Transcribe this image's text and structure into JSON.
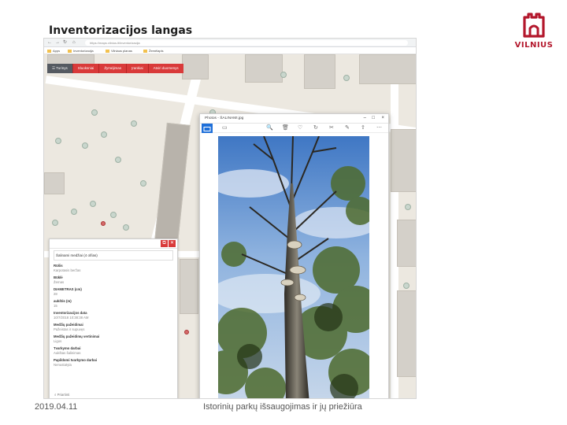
{
  "slide": {
    "title": "Inventorizacijos langas",
    "logo_text": "VILNIUS",
    "footer_date": "2019.04.11",
    "footer_caption": "Istorinių parkų išsaugojimas ir jų priežiūra"
  },
  "colors": {
    "brand_red": "#b3172c",
    "toolbar_red": "#d93a3a",
    "toolbar_dark": "#555a61",
    "viewer_accent": "#1e6fd9"
  },
  "browser": {
    "url": "https://maps.vilnius.lt/inventorizacija",
    "bookmarks": [
      "Apps",
      "Inventorizacija",
      "Vilniaus planas",
      "Žemėlapis"
    ]
  },
  "map_toolbar": {
    "items": [
      {
        "label": "☰ Turinys",
        "style": "dark"
      },
      {
        "label": "Sluoksniai",
        "style": "red"
      },
      {
        "label": "Žymėjimas",
        "style": "red"
      },
      {
        "label": "Įrankiai",
        "style": "red"
      },
      {
        "label": "Atviri duomenys",
        "style": "red"
      }
    ]
  },
  "identify_panel": {
    "title": "Šalinami medžiai (4 of/ias)",
    "fields": [
      {
        "label": "Rūšis",
        "value": "Karpotasis beržas"
      },
      {
        "label": "Būklė",
        "value": "Žemas"
      },
      {
        "label": "DIAMETRAS (cm)",
        "value": "28"
      },
      {
        "label": "aukštis (m)",
        "value": "15"
      },
      {
        "label": "Inventorizacijos data",
        "value": "10/7/2018 10:38:38 AM"
      },
      {
        "label": "Medžių pažeidimai",
        "value": "Pažeistas ir supuvęs"
      },
      {
        "label": "Medžių pažeidimų vertinimai",
        "value": "Ligos"
      },
      {
        "label": "Tvarkymo darbai",
        "value": "Aukštas šalinimas"
      },
      {
        "label": "Papildomi tvarkymo darbai",
        "value": "Nenustatyta"
      }
    ],
    "footer": "Priartinti"
  },
  "viewer": {
    "title": "Photos - ŠALINAMI.jpg"
  },
  "icons": {
    "back": "←",
    "forward": "→",
    "reload": "↻",
    "home": "⌂",
    "minimize": "–",
    "maximize": "□",
    "close": "×",
    "zoom": "🔍",
    "delete": "🗑",
    "favorite": "♡",
    "rotate": "↻",
    "crop": "✂",
    "edit": "✎",
    "share": "⇪",
    "more": "⋯",
    "expand": "⤢",
    "popout": "⧉",
    "panel_close": "✕",
    "search": "⌕"
  }
}
